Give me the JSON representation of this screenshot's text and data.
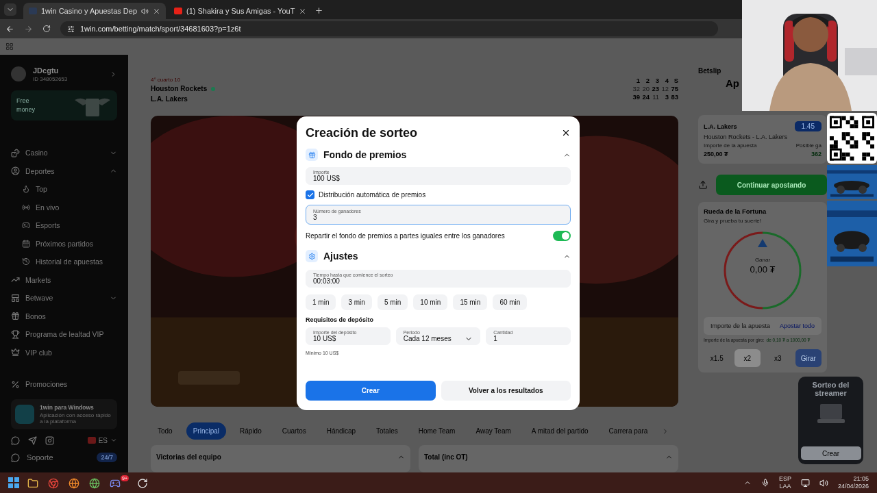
{
  "browser": {
    "tabs": [
      {
        "title": "1win Casino y Apuestas Dep",
        "selected": true,
        "audio": true
      },
      {
        "title": "(1) Shakira y Sus Amigas - YouT",
        "selected": false,
        "audio": false
      }
    ],
    "url": "1win.com/betting/match/sport/34681603?p=1z6t"
  },
  "sidebar": {
    "user": {
      "name": "JDcgtu",
      "id": "ID 348052653"
    },
    "promo": "Free money",
    "nav": [
      {
        "label": "Casino",
        "kind": "group",
        "expanded": false
      },
      {
        "label": "Deportes",
        "kind": "group",
        "expanded": true,
        "children": [
          {
            "label": "Top"
          },
          {
            "label": "En vivo"
          },
          {
            "label": "Esports"
          },
          {
            "label": "Próximos partidos"
          },
          {
            "label": "Historial de apuestas"
          }
        ]
      },
      {
        "label": "Markets",
        "kind": "link"
      },
      {
        "label": "Betwave",
        "kind": "group",
        "expanded": false
      },
      {
        "label": "Bonos",
        "kind": "link"
      },
      {
        "label": "Programa de lealtad VIP",
        "kind": "link"
      },
      {
        "label": "VIP club",
        "kind": "link"
      }
    ],
    "promotions": "Promociones",
    "app": {
      "title": "1win para Windows",
      "subtitle": "Aplicación con acceso rápido a la plataforma"
    },
    "language": "ES",
    "support": {
      "label": "Soporte",
      "badge": "24/7"
    }
  },
  "match": {
    "status": "4° cuarto 10",
    "periods": [
      "1",
      "2",
      "3",
      "4",
      "S"
    ],
    "teams": [
      {
        "name": "Houston Rockets",
        "serving": true,
        "scores": [
          {
            "value": "32",
            "faded": true
          },
          {
            "value": "20",
            "faded": true
          },
          {
            "value": "23",
            "faded": false
          },
          {
            "value": "12",
            "faded": true
          },
          {
            "value": "75",
            "faded": false
          }
        ]
      },
      {
        "name": "L.A. Lakers",
        "serving": false,
        "scores": [
          {
            "value": "39",
            "faded": false
          },
          {
            "value": "24",
            "faded": false
          },
          {
            "value": "11",
            "faded": true
          },
          {
            "value": "3",
            "faded": false
          },
          {
            "value": "83",
            "faded": false
          }
        ]
      }
    ],
    "video": {
      "kind": "picture"
    },
    "market_tabs": [
      {
        "label": "Todo",
        "selected": false
      },
      {
        "label": "Principal",
        "selected": true
      },
      {
        "label": "Rápido",
        "selected": false
      },
      {
        "label": "Cuartos",
        "selected": false
      },
      {
        "label": "Hándicap",
        "selected": false
      },
      {
        "label": "Totales",
        "selected": false
      },
      {
        "label": "Home Team",
        "selected": false
      },
      {
        "label": "Away Team",
        "selected": false
      },
      {
        "label": "A mitad del partido",
        "selected": false
      },
      {
        "label": "Carrera para",
        "selected": false
      }
    ],
    "markets": [
      {
        "title": "Victorias del equipo",
        "expanded": true
      },
      {
        "title": "Total (inc OT)",
        "expanded": true
      }
    ]
  },
  "betslip": {
    "title": "Betslip",
    "heading": "Ap",
    "bet": {
      "pick": "L.A. Lakers",
      "event": "Houston Rockets - L.A. Lakers",
      "odds": "1.45",
      "stake_label": "Importe de la apuesta",
      "stake": "250,00 ₮",
      "win_label": "Posible ga",
      "win": "362"
    },
    "continue": "Continuar apostando",
    "wheel": {
      "title": "Rueda de la Fortuna",
      "subtitle": "Gira y prueba tu suerte!",
      "win_label": "Ganar",
      "win": "0,00 ₮",
      "placeholder": "Importe de la apuesta",
      "all": "Apostar todo",
      "range_label": "Importe de la apuesta por giro:",
      "range": "de 0,10 ₮ a 1000,00 ₮",
      "multipliers": [
        {
          "label": "x1.5",
          "selected": false
        },
        {
          "label": "x2",
          "selected": true
        },
        {
          "label": "x3",
          "selected": false
        }
      ],
      "spin": "Girar"
    },
    "streamer": {
      "title": "Sorteo del streamer",
      "button": "Crear"
    }
  },
  "dialog": {
    "title": "Creación de sorteo",
    "prize": {
      "title": "Fondo de premios",
      "expanded": true,
      "amount": {
        "label": "Importe",
        "value": "100 US$",
        "focused": false
      },
      "auto": {
        "label": "Distribución automática de premios",
        "checked": true
      },
      "winners": {
        "label": "Número de ganadores",
        "value": "3",
        "focused": true
      },
      "equal": {
        "label": "Repartir el fondo de premios a partes iguales entre los ganadores",
        "on": true
      }
    },
    "settings": {
      "title": "Ajustes",
      "expanded": true,
      "time": {
        "label": "Tiempo hasta que comience el sorteo",
        "value": "00:03:00",
        "focused": false
      },
      "presets": [
        "1 min",
        "3 min",
        "5 min",
        "10 min",
        "15 min",
        "60 min"
      ],
      "deposit_title": "Requisitos de depósito",
      "deposit": {
        "label": "Importe del depósito",
        "value": "10 US$"
      },
      "period": {
        "label": "Periodo",
        "value": "Cada 12 meses"
      },
      "count": {
        "label": "Cantidad",
        "value": "1"
      },
      "hint": "Mínimo 10 US$"
    },
    "create": "Crear",
    "back": "Volver a los resultados"
  },
  "taskbar": {
    "badge": "9+",
    "lang_top": "ESP",
    "lang_bottom": "LAA",
    "time": "21:05",
    "date": "24/04/2026"
  }
}
